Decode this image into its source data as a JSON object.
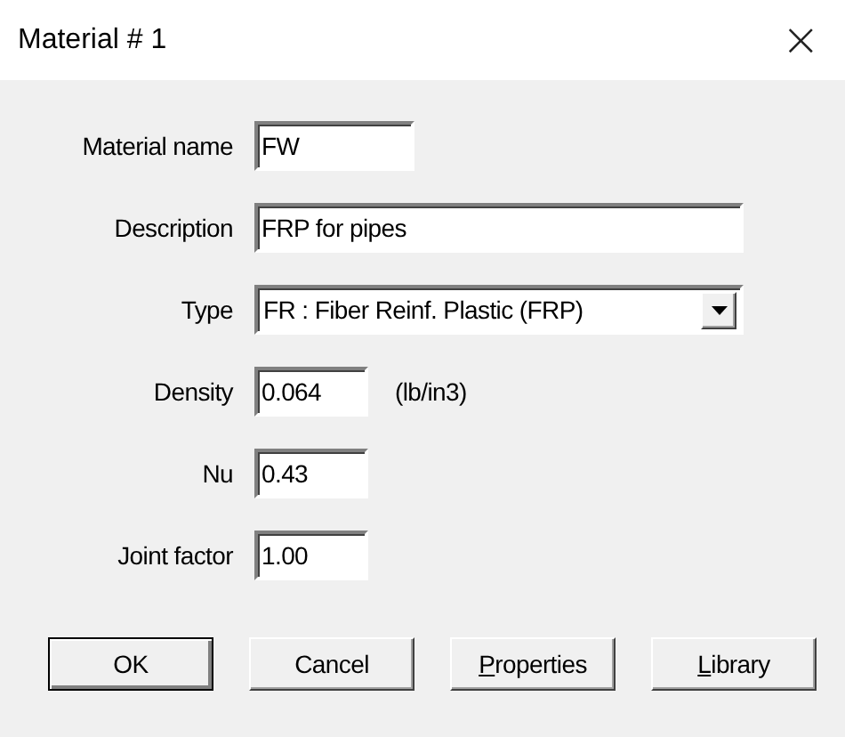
{
  "window": {
    "title": "Material # 1",
    "close": "×"
  },
  "fields": [
    {
      "kind": "text",
      "label": "Material name",
      "value": "FW"
    },
    {
      "kind": "text",
      "label": "Description",
      "value": "FRP for pipes"
    },
    {
      "kind": "select",
      "label": "Type",
      "value": "FR : Fiber Reinf. Plastic (FRP)"
    },
    {
      "kind": "text",
      "label": "Density",
      "value": "0.064",
      "unit": "(lb/in3)"
    },
    {
      "kind": "text",
      "label": "Nu",
      "value": "0.43"
    },
    {
      "kind": "text",
      "label": "Joint factor",
      "value": "1.00"
    }
  ],
  "buttons": [
    {
      "label": "OK",
      "default": true,
      "underline_first": false
    },
    {
      "label": "Cancel",
      "default": false,
      "underline_first": false
    },
    {
      "label": "Properties",
      "default": false,
      "underline_first": true
    },
    {
      "label": "Library",
      "default": false,
      "underline_first": true
    }
  ]
}
